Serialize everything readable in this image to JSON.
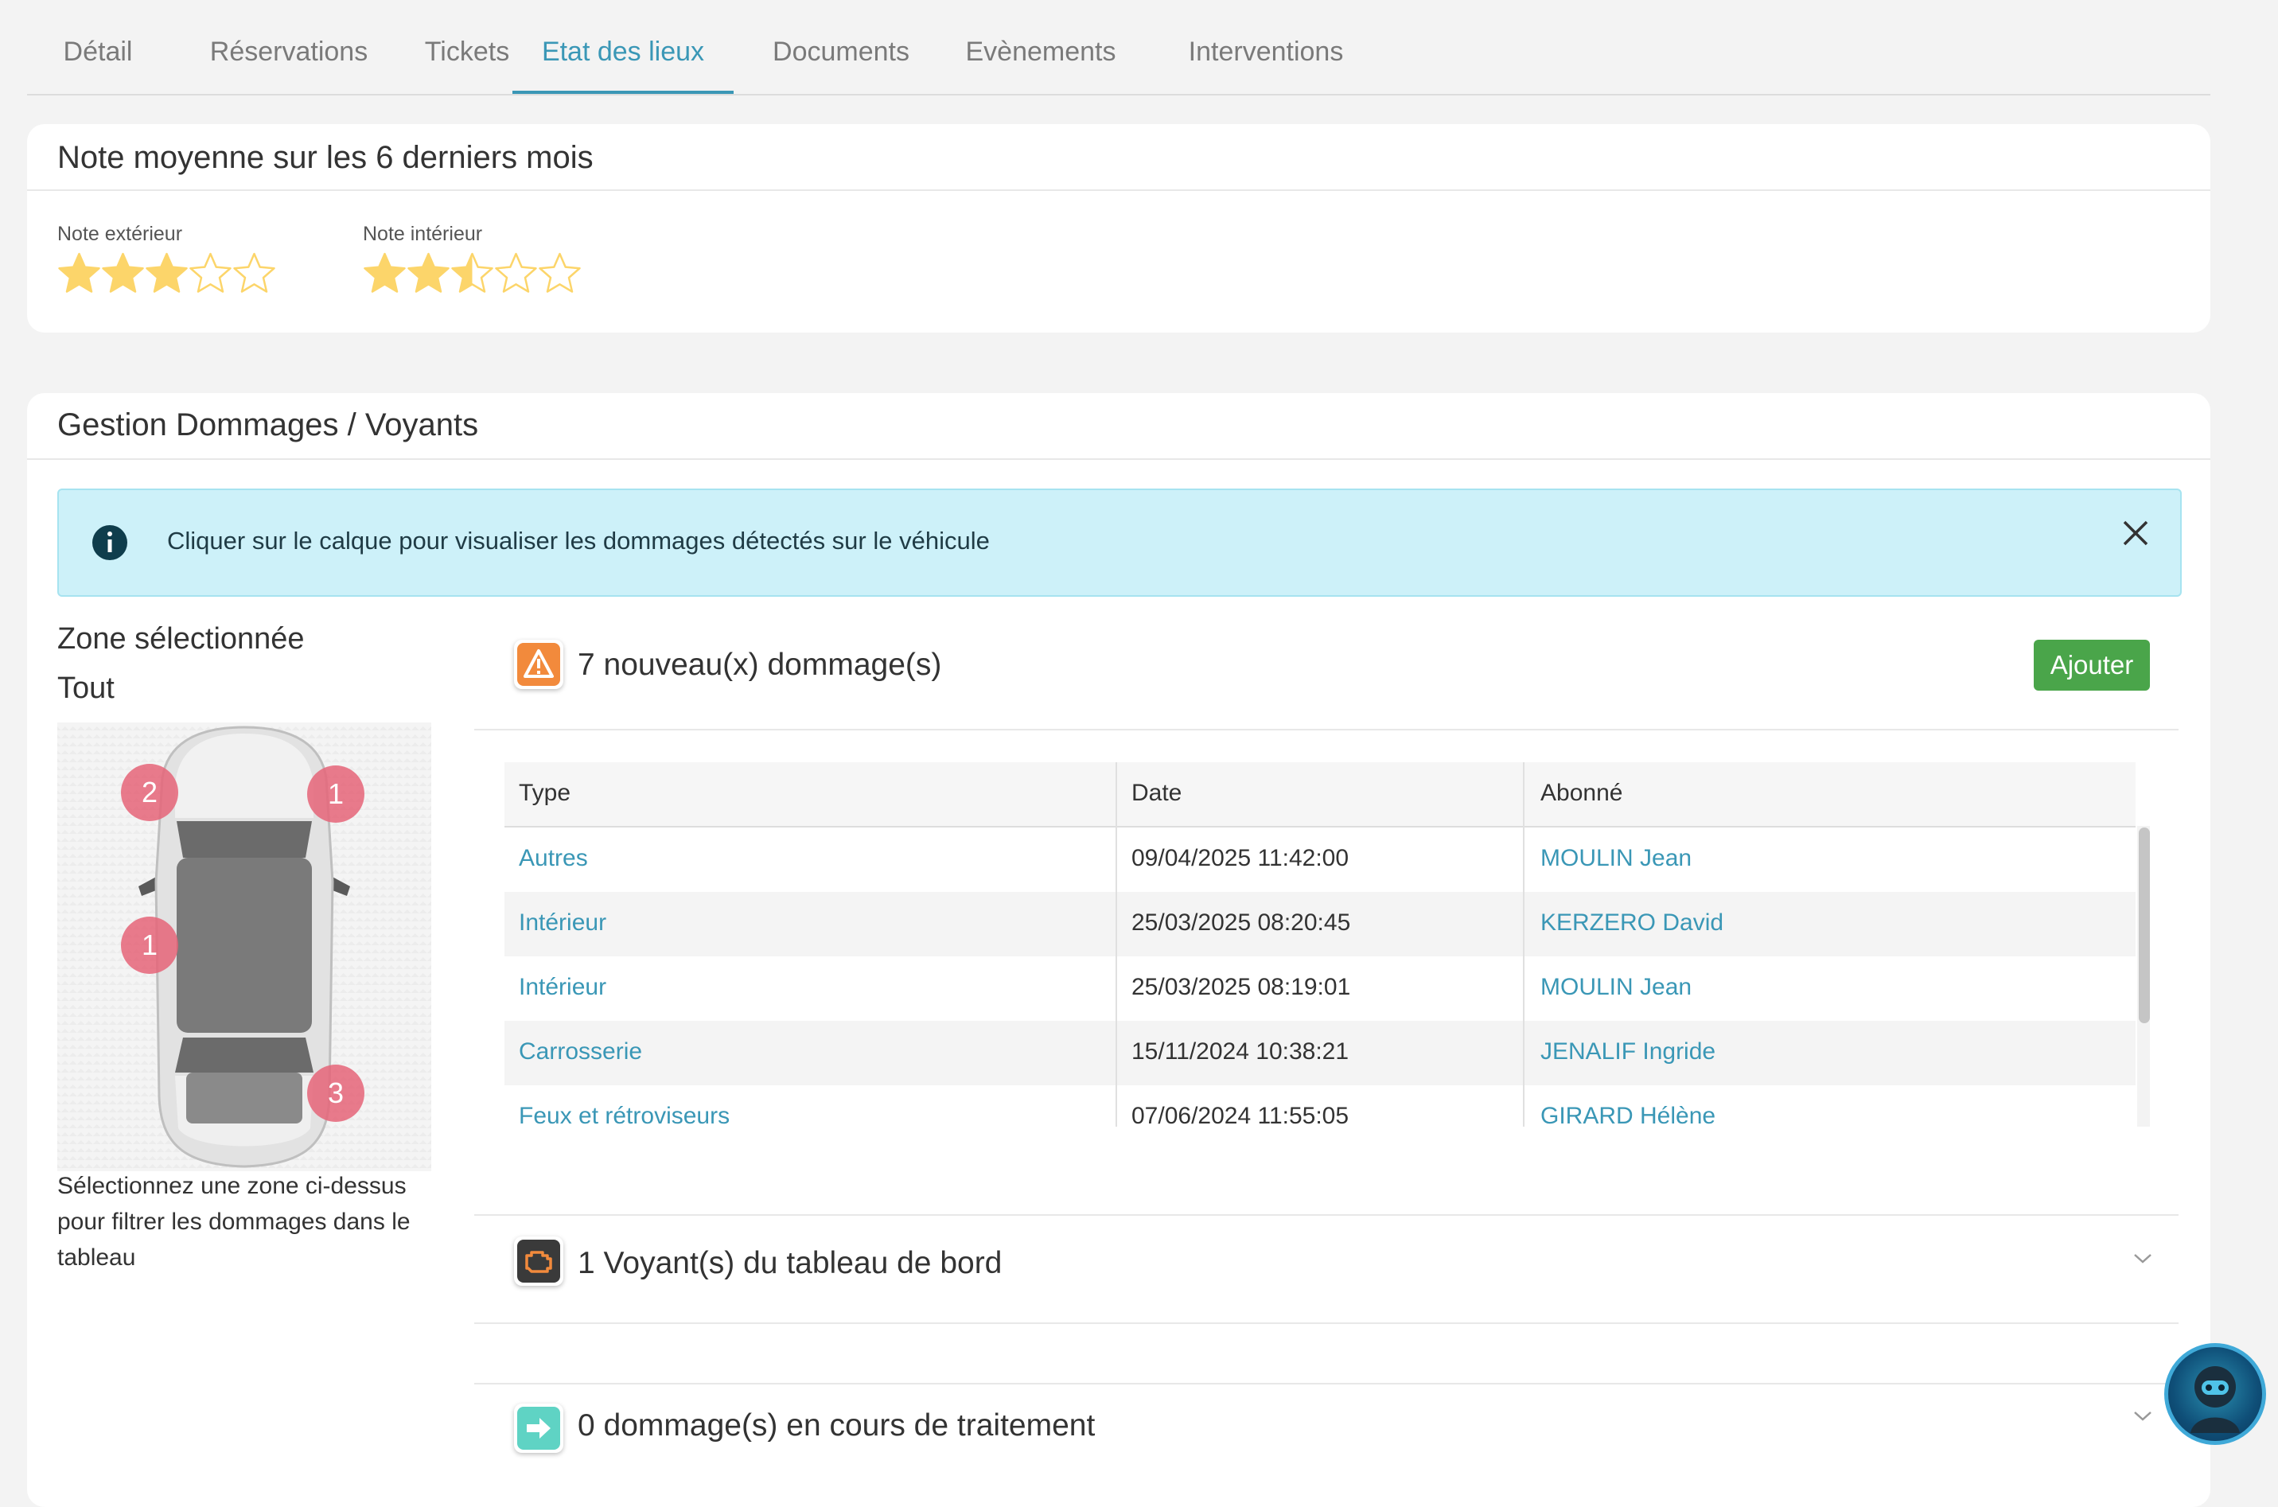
{
  "tabs": [
    {
      "label": "Détail",
      "active": false
    },
    {
      "label": "Réservations",
      "active": false
    },
    {
      "label": "Tickets",
      "active": false
    },
    {
      "label": "Etat des lieux",
      "active": true
    },
    {
      "label": "Documents",
      "active": false
    },
    {
      "label": "Evènements",
      "active": false
    },
    {
      "label": "Interventions",
      "active": false
    }
  ],
  "ratings": {
    "title": "Note moyenne sur les 6 derniers mois",
    "exterior": {
      "label": "Note extérieur",
      "value": 3,
      "max": 5
    },
    "interior": {
      "label": "Note intérieur",
      "value": 2.5,
      "max": 5
    },
    "star_color": "#fcd56a"
  },
  "damages": {
    "title": "Gestion Dommages / Voyants",
    "info_text": "Cliquer sur le calque pour visualiser les dommages détectés sur le véhicule",
    "zone_label": "Zone sélectionnée",
    "zone_value": "Tout",
    "zone_help": "Sélectionnez une zone ci-dessus pour filtrer les dommages dans le tableau",
    "badges": [
      "2",
      "1",
      "1",
      "3"
    ],
    "new_damages": {
      "title": "7 nouveau(x) dommage(s)",
      "add_label": "Ajouter",
      "columns": [
        "Type",
        "Date",
        "Abonné"
      ],
      "rows": [
        {
          "type": "Autres",
          "date": "09/04/2025 11:42:00",
          "subscriber": "MOULIN Jean"
        },
        {
          "type": "Intérieur",
          "date": "25/03/2025 08:20:45",
          "subscriber": "KERZERO David"
        },
        {
          "type": "Intérieur",
          "date": "25/03/2025 08:19:01",
          "subscriber": "MOULIN Jean"
        },
        {
          "type": "Carrosserie",
          "date": "15/11/2024 10:38:21",
          "subscriber": "JENALIF Ingride"
        },
        {
          "type": "Feux et rétroviseurs",
          "date": "07/06/2024 11:55:05",
          "subscriber": "GIRARD Hélène"
        }
      ]
    },
    "warning_lights": {
      "title": "1 Voyant(s) du tableau de bord"
    },
    "in_progress": {
      "title": "0 dommage(s) en cours de traitement"
    }
  },
  "colors": {
    "accent": "#3a97b6",
    "add_button": "#4aa54a",
    "info_bg": "#cdf1f9",
    "badge": "#e56478"
  },
  "icons": {
    "info": "info-icon",
    "close": "close-icon",
    "new_damages": "warning-triangle-icon",
    "warning_lights": "engine-icon",
    "in_progress": "arrow-right-icon",
    "assistant": "assistant-avatar"
  }
}
